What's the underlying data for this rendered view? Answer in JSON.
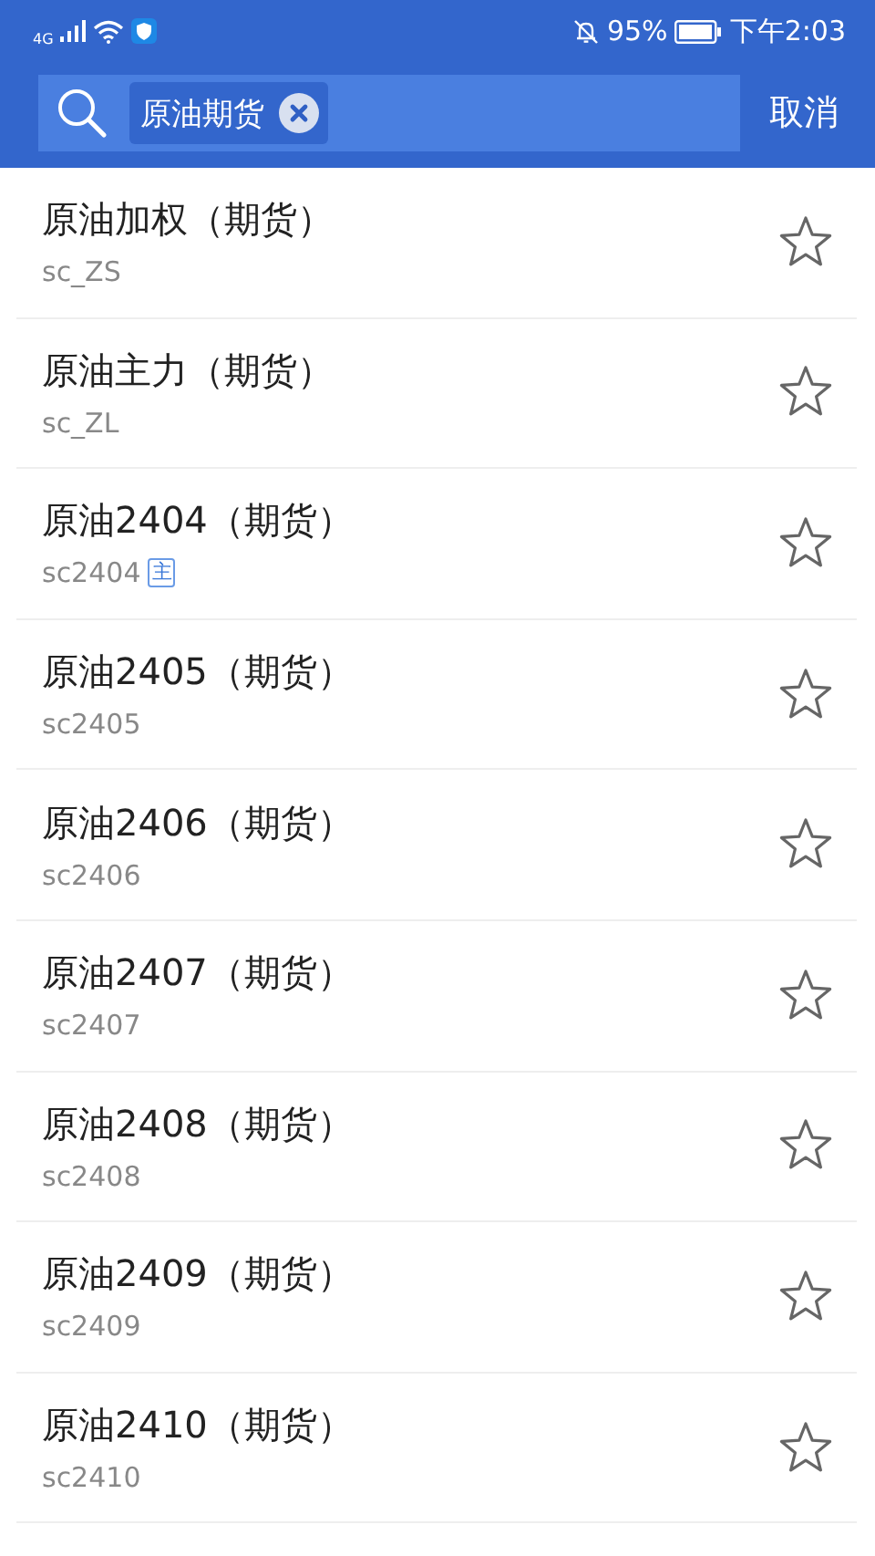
{
  "status_bar": {
    "network": "4G",
    "battery": "95%",
    "time": "下午2:03"
  },
  "search": {
    "tag": "原油期货",
    "cancel": "取消"
  },
  "results": [
    {
      "name": "原油加权（期货）",
      "code": "sc_ZS",
      "favorite": false
    },
    {
      "name": "原油主力（期货）",
      "code": "sc_ZL",
      "favorite": false
    },
    {
      "name": "原油2404（期货）",
      "code": "sc2404",
      "badge": "主",
      "favorite": false
    },
    {
      "name": "原油2405（期货）",
      "code": "sc2405",
      "favorite": false
    },
    {
      "name": "原油2406（期货）",
      "code": "sc2406",
      "favorite": false
    },
    {
      "name": "原油2407（期货）",
      "code": "sc2407",
      "favorite": false
    },
    {
      "name": "原油2408（期货）",
      "code": "sc2408",
      "favorite": false
    },
    {
      "name": "原油2409（期货）",
      "code": "sc2409",
      "favorite": false
    },
    {
      "name": "原油2410（期货）",
      "code": "sc2410",
      "favorite": false
    }
  ]
}
